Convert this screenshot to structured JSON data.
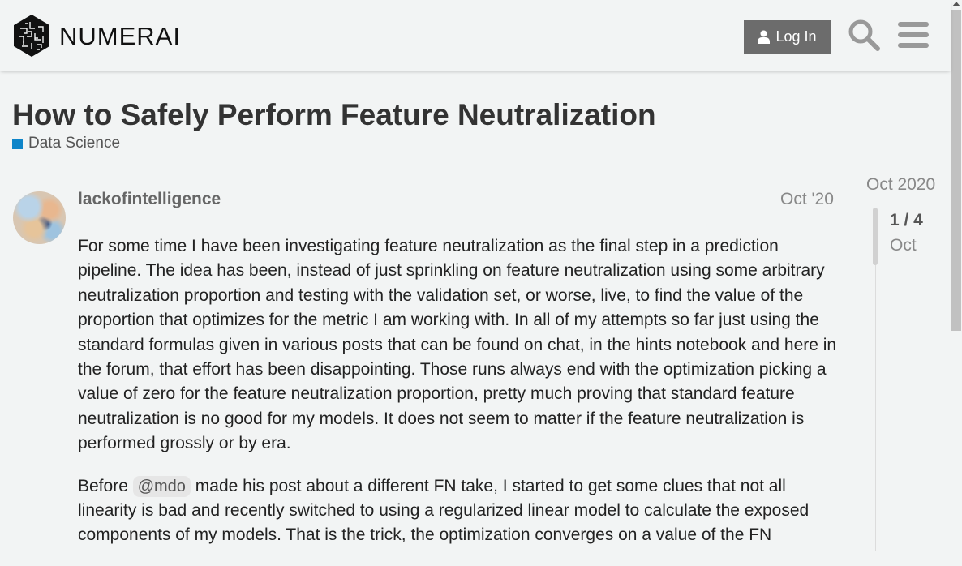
{
  "header": {
    "logo_text": "NUMERAI",
    "login_label": "Log In",
    "search_icon": "search-icon",
    "menu_icon": "hamburger-icon"
  },
  "topic": {
    "title": "How to Safely Perform Feature Neutralization",
    "category": "Data Science",
    "category_color": "#0e85c9"
  },
  "post": {
    "username": "lackofintelligence",
    "date": "Oct '20",
    "paragraph1": "For some time I have been investigating feature neutralization as the final step in a prediction pipeline. The idea has been, instead of just sprinkling on feature neutralization using some arbitrary neutralization proportion and testing with the validation set, or worse, live, to find the value of the proportion that optimizes for the metric I am working with. In all of my attempts so far just using the standard formulas given in various posts that can be found on chat, in the hints notebook and here in the forum, that effort has been disappointing. Those runs always end with the optimization picking a value of zero for the feature neutralization proportion, pretty much proving that standard feature neutralization is no good for my models. It does not seem to matter if the feature neutralization is performed grossly or by era.",
    "paragraph2_before": "Before",
    "mention": "@mdo",
    "paragraph2_after": "made his post about a different FN take, I started to get some clues that not all linearity is bad and recently switched to using a regularized linear model to calculate the exposed components of my models. That is the trick, the optimization converges on a value of the FN"
  },
  "timeline": {
    "top_date": "Oct 2020",
    "position": "1 / 4",
    "current_month": "Oct"
  }
}
